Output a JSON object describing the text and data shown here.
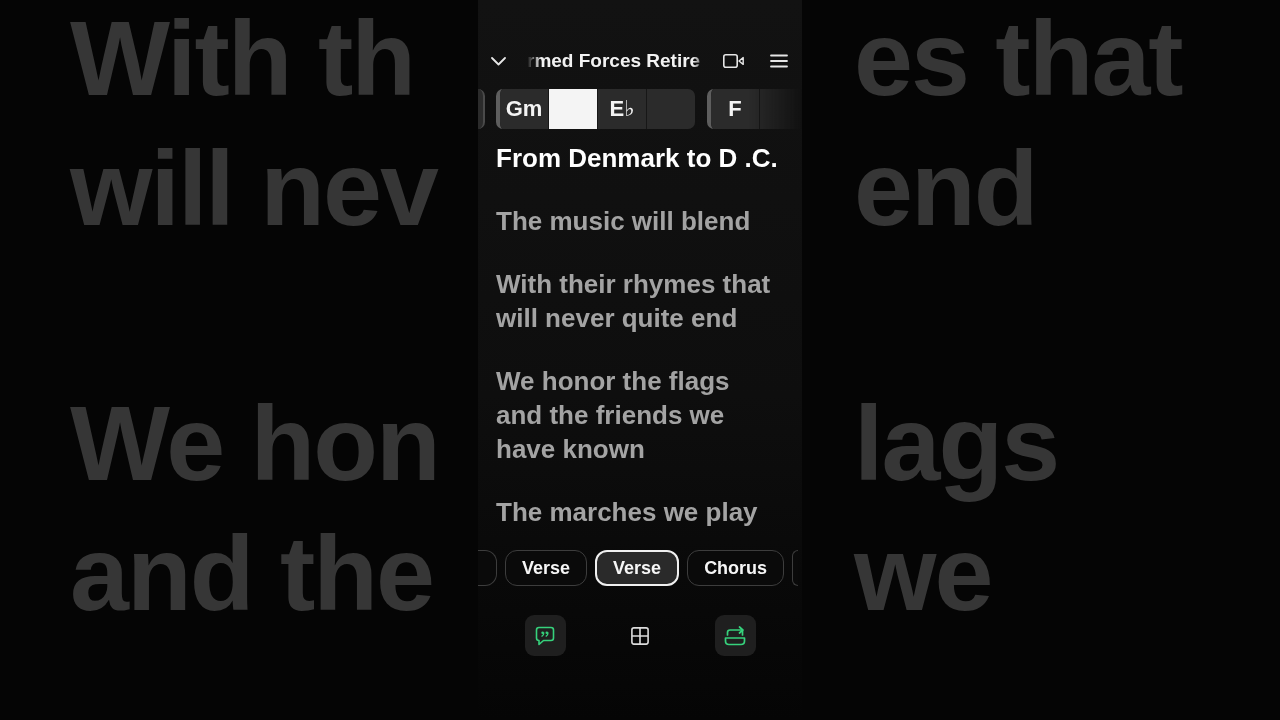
{
  "backdrop": {
    "left": [
      [
        "With th",
        "will nev"
      ],
      [
        "We hon",
        "and the"
      ]
    ],
    "right": [
      [
        "es that",
        "end"
      ],
      [
        "lags",
        "we"
      ]
    ]
  },
  "header": {
    "title": "rmed Forces Retire"
  },
  "chord_bar": {
    "measures": [
      {
        "cells": [
          {
            "chord": "Gm",
            "selected": false
          },
          {
            "selected": true
          },
          {
            "chord": "E♭",
            "selected": false
          },
          {
            "selected": false
          }
        ]
      },
      {
        "cells": [
          {
            "chord": "F",
            "selected": false
          },
          {
            "selected": false
          }
        ]
      }
    ]
  },
  "lyrics": [
    {
      "text": "From Denmark to D .C.",
      "selected": true
    },
    {
      "text": "The music will blend",
      "selected": false
    },
    {
      "text": "With their rhymes that will never quite end",
      "selected": false
    },
    {
      "text": "We honor the flags and the friends we have known",
      "selected": false
    },
    {
      "text": "The marches we play",
      "selected": false
    }
  ],
  "sections": [
    {
      "label": "Verse",
      "selected": false
    },
    {
      "label": "Verse",
      "selected": true
    },
    {
      "label": "Chorus",
      "selected": false
    }
  ],
  "toolbar": [
    {
      "kind": "quote",
      "on": true
    },
    {
      "kind": "grid",
      "on": false
    },
    {
      "kind": "repeat",
      "on": true
    }
  ]
}
